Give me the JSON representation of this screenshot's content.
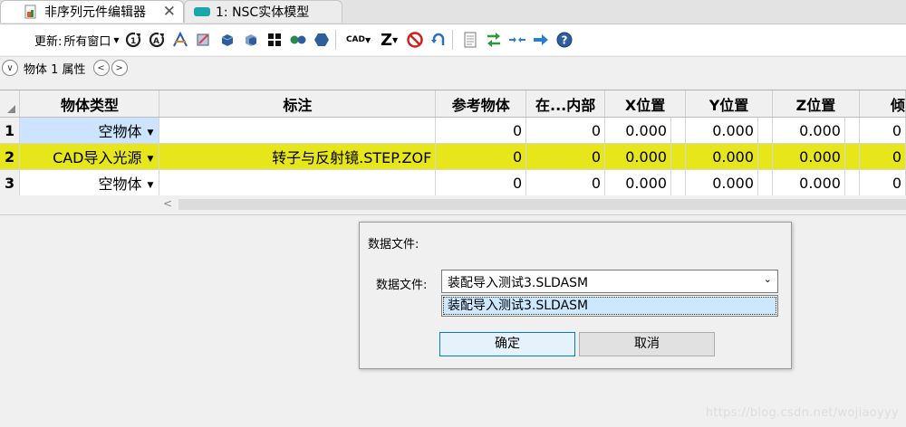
{
  "tabs": [
    {
      "label": "非序列元件编辑器",
      "close": "✕"
    },
    {
      "label": "1: NSC实体模型"
    }
  ],
  "toolbar": {
    "update_label": "更新:",
    "update_value": "所有窗口",
    "cad_label": "CAD",
    "z_label": "Z",
    "icons": [
      "refresh-icon",
      "refresh-all-icon",
      "ray-trace-icon",
      "detector-icon",
      "solid-model-icon",
      "shaded-model-icon",
      "layout-icon",
      "dual-sources-icon",
      "hexagon-icon",
      "cad-icon",
      "z-menu-icon",
      "stop-icon",
      "undo-icon",
      "document-icon",
      "exchange-icon",
      "collapse-icon",
      "arrow-right-icon",
      "help-icon"
    ]
  },
  "props": {
    "title": "物体 1 属性",
    "collapse": "∨",
    "prev": "<",
    "next": ">"
  },
  "grid": {
    "columns": [
      "物体类型",
      "标注",
      "参考物体",
      "在...内部",
      "X位置",
      "Y位置",
      "Z位置",
      "倾"
    ],
    "rows": [
      {
        "num": "1",
        "type": "空物体",
        "comment": "",
        "ref": "0",
        "inside": "0",
        "x": "0.000",
        "y": "0.000",
        "z": "0.000",
        "tilt": "0"
      },
      {
        "num": "2",
        "type": "CAD导入光源",
        "comment": "转子与反射镜.STEP.ZOF",
        "ref": "0",
        "inside": "0",
        "x": "0.000",
        "y": "0.000",
        "z": "0.000",
        "tilt": "0"
      },
      {
        "num": "3",
        "type": "空物体",
        "comment": "",
        "ref": "0",
        "inside": "0",
        "x": "0.000",
        "y": "0.000",
        "z": "0.000",
        "tilt": "0"
      }
    ],
    "highlight_color": "#e6e61a"
  },
  "dialog": {
    "title": "数据文件:",
    "field_label": "数据文件:",
    "selected": "装配导入测试3.SLDASM",
    "options": [
      "装配导入测试3.SLDASM"
    ],
    "ok": "确定",
    "cancel": "取消"
  },
  "watermark": "https://blog.csdn.net/wojiaoyyy"
}
